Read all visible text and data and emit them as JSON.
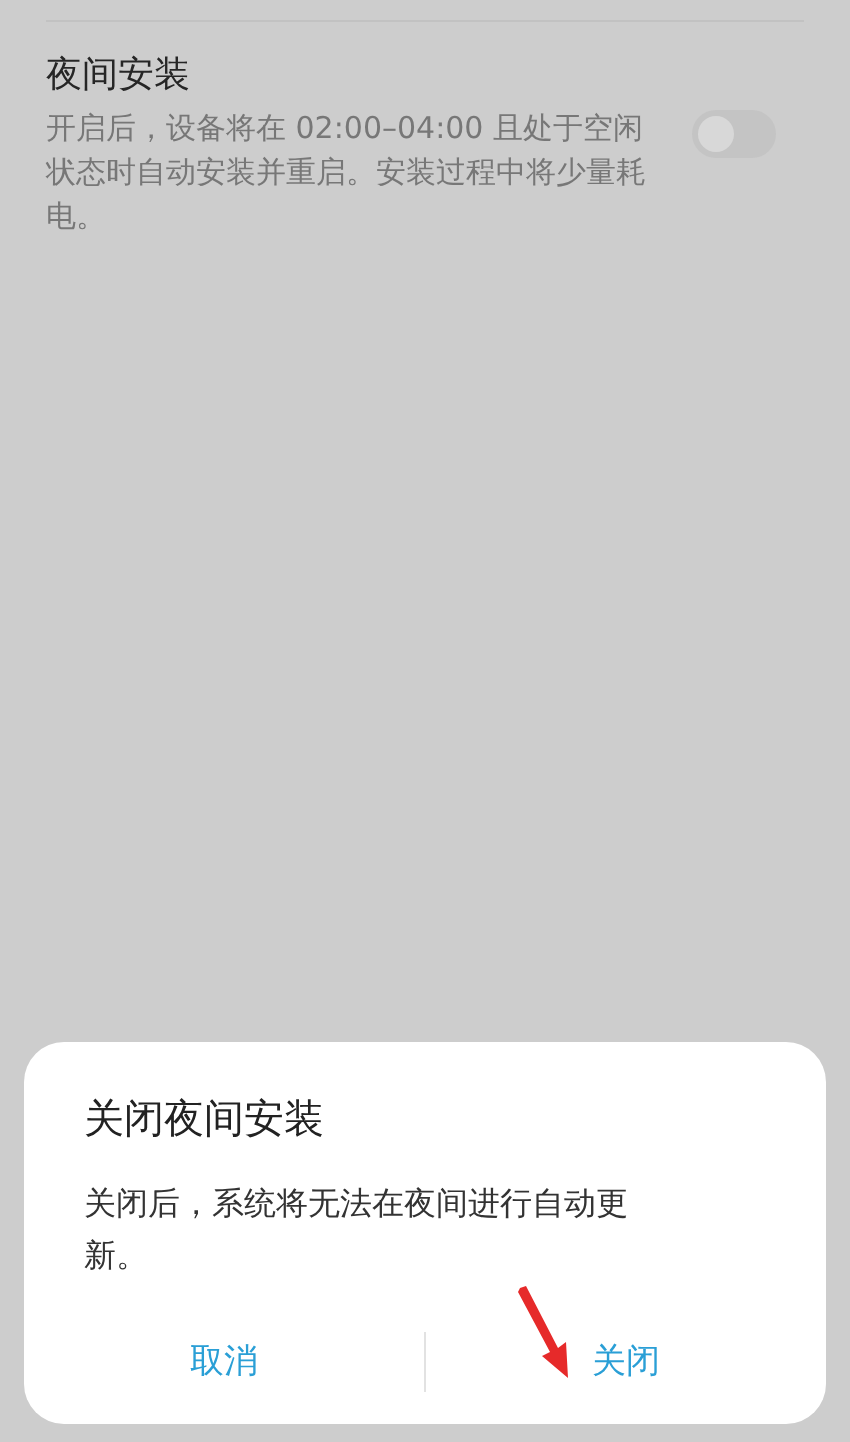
{
  "setting": {
    "title": "夜间安装",
    "description": "开启后，设备将在 02:00–04:00 且处于空闲状态时自动安装并重启。安装过程中将少量耗电。",
    "on": false
  },
  "dialog": {
    "title": "关闭夜间安装",
    "message": "关闭后，系统将无法在夜间进行自动更新。",
    "buttons": [
      {
        "label": "取消"
      },
      {
        "label": "关闭"
      }
    ]
  }
}
